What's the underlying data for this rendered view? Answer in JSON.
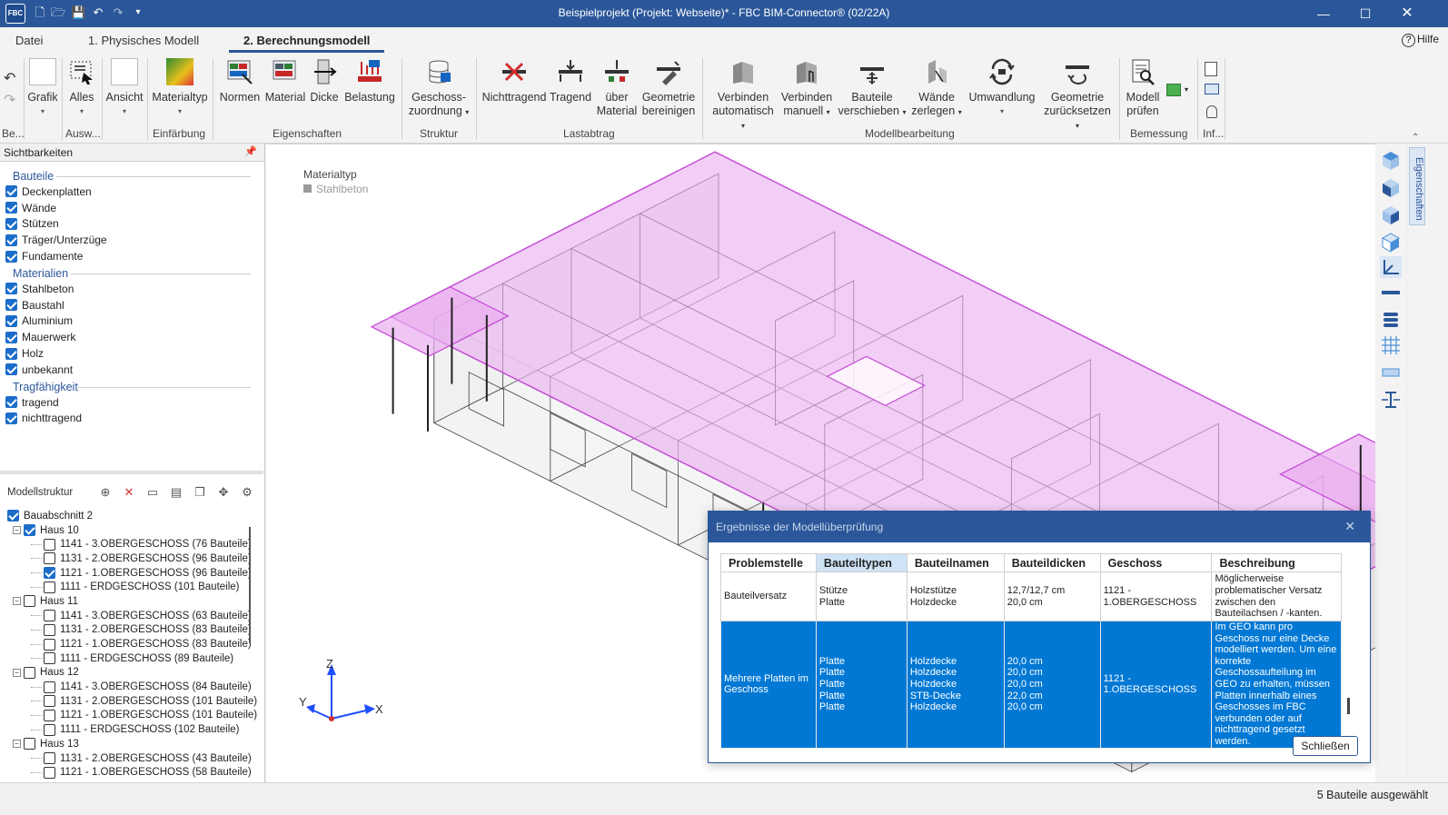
{
  "titlebar": {
    "logo": "FBC",
    "title": "Beispielprojekt (Projekt: Webseite)*  -  FBC BIM-Connector® (02/22A)"
  },
  "tabs": [
    "Datei",
    "1. Physisches Modell",
    "2. Berechnungsmodell"
  ],
  "help_label": "Hilfe",
  "ribbon": {
    "buttons": {
      "grafik": "Grafik",
      "alles": "Alles",
      "ansicht": "Ansicht",
      "materialtyp": "Materialtyp",
      "normen": "Normen",
      "material": "Material",
      "dicke": "Dicke",
      "belastung": "Belastung",
      "geschoss_1": "Geschoss-",
      "geschoss_2": "zuordnung",
      "nichttragend": "Nichttragend",
      "tragend": "Tragend",
      "uber_1": "über",
      "uber_2": "Material",
      "geometrie_1": "Geometrie",
      "geometrie_2": "bereinigen",
      "verb_auto_1": "Verbinden",
      "verb_auto_2": "automatisch",
      "verb_man_1": "Verbinden",
      "verb_man_2": "manuell",
      "bauteile_1": "Bauteile",
      "bauteile_2": "verschieben",
      "waende_1": "Wände",
      "waende_2": "zerlegen",
      "umwandlung": "Umwandlung",
      "geo_reset_1": "Geometrie",
      "geo_reset_2": "zurücksetzen",
      "modell_1": "Modell",
      "modell_2": "prüfen"
    },
    "groups": {
      "be": "Be...",
      "ausw": "Ausw...",
      "einfaerbung": "Einfärbung",
      "eigenschaften": "Eigenschaften",
      "struktur": "Struktur",
      "lastabtrag": "Lastabtrag",
      "modellbearbeitung": "Modellbearbeitung",
      "bemessung": "Bemessung",
      "inf": "Inf..."
    }
  },
  "visibility": {
    "header": "Sichtbarkeiten",
    "sections": [
      {
        "title": "Bauteile",
        "items": [
          "Deckenplatten",
          "Wände",
          "Stützen",
          "Träger/Unterzüge",
          "Fundamente"
        ]
      },
      {
        "title": "Materialien",
        "items": [
          "Stahlbeton",
          "Baustahl",
          "Aluminium",
          "Mauerwerk",
          "Holz",
          "unbekannt"
        ]
      },
      {
        "title": "Tragfähigkeit",
        "items": [
          "tragend",
          "nichttragend"
        ]
      }
    ]
  },
  "model_structure": {
    "title": "Modellstruktur",
    "root": "Bauabschnitt 2",
    "houses": [
      {
        "name": "Haus 10",
        "checked": true,
        "floors": [
          {
            "label": "1141 - 3.OBERGESCHOSS (76 Bauteile)",
            "checked": false
          },
          {
            "label": "1131 - 2.OBERGESCHOSS (96 Bauteile)",
            "checked": false
          },
          {
            "label": "1121 - 1.OBERGESCHOSS (96 Bauteile)",
            "checked": true
          },
          {
            "label": "1111 - ERDGESCHOSS (101 Bauteile)",
            "checked": false
          }
        ]
      },
      {
        "name": "Haus 11",
        "checked": false,
        "floors": [
          {
            "label": "1141 - 3.OBERGESCHOSS (63 Bauteile)",
            "checked": false
          },
          {
            "label": "1131 - 2.OBERGESCHOSS (83 Bauteile)",
            "checked": false
          },
          {
            "label": "1121 - 1.OBERGESCHOSS (83 Bauteile)",
            "checked": false
          },
          {
            "label": "1111 - ERDGESCHOSS (89 Bauteile)",
            "checked": false
          }
        ]
      },
      {
        "name": "Haus 12",
        "checked": false,
        "floors": [
          {
            "label": "1141 - 3.OBERGESCHOSS (84 Bauteile)",
            "checked": false
          },
          {
            "label": "1131 - 2.OBERGESCHOSS (101 Bauteile)",
            "checked": false
          },
          {
            "label": "1121 - 1.OBERGESCHOSS (101 Bauteile)",
            "checked": false
          },
          {
            "label": "1111 - ERDGESCHOSS (102 Bauteile)",
            "checked": false
          }
        ]
      },
      {
        "name": "Haus 13",
        "checked": false,
        "floors": [
          {
            "label": "1131 - 2.OBERGESCHOSS (43 Bauteile)",
            "checked": false
          },
          {
            "label": "1121 - 1.OBERGESCHOSS (58 Bauteile)",
            "checked": false
          }
        ]
      }
    ]
  },
  "viewport": {
    "legend_title": "Materialtyp",
    "legend_item": "Stahlbeton",
    "axes": {
      "z": "Z",
      "y": "Y",
      "x": "X"
    },
    "colors": {
      "slab_fill": "#e9aef0",
      "slab_edge": "#c64fd6",
      "wall_line": "#3c3c3c",
      "axis": "#1f4fff"
    }
  },
  "side_tab": "Eigenschaften",
  "dialog": {
    "title": "Ergebnisse der Modellüberprüfung",
    "columns": [
      "Problemstelle",
      "Bauteiltypen",
      "Bauteilnamen",
      "Bauteildicken",
      "Geschoss",
      "Beschreibung"
    ],
    "rows": [
      {
        "problem": "Bauteilversatz",
        "types": "Stütze\nPlatte",
        "names": "Holzstütze\nHolzdecke",
        "thickness": "12,7/12,7 cm\n20,0 cm",
        "floor": "1121 -\n1.OBERGESCHOSS",
        "description": "Möglicherweise problematischer Versatz zwischen den Bauteilachsen / -kanten."
      },
      {
        "problem": "Mehrere Platten im Geschoss",
        "types": "Platte\nPlatte\nPlatte\nPlatte\nPlatte",
        "names": "Holzdecke\nHolzdecke\nHolzdecke\nSTB-Decke\nHolzdecke",
        "thickness": "20,0 cm\n20,0 cm\n20,0 cm\n22,0 cm\n20,0 cm",
        "floor": "1121 -\n1.OBERGESCHOSS",
        "description": "Im GEO kann pro Geschoss nur eine Decke modelliert werden. Um eine korrekte Geschossaufteilung im GEO zu erhalten, müssen Platten innerhalb eines Geschosses im FBC verbunden oder auf nichttragend gesetzt werden."
      }
    ],
    "close_button": "Schließen"
  },
  "status": "5 Bauteile ausgewählt",
  "colors": {
    "accent": "#2b579a",
    "selection": "#0078d4",
    "checkbox": "#1c6dc9"
  }
}
